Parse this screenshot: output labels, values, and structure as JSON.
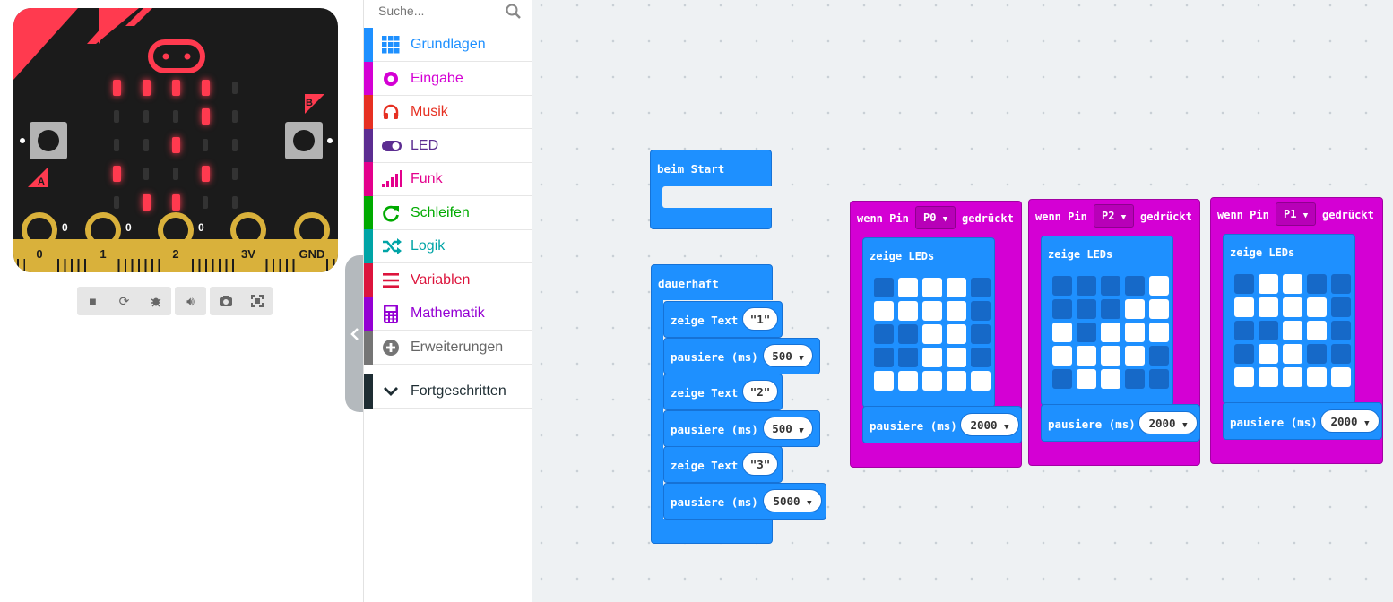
{
  "simulator": {
    "pins": [
      "0",
      "1",
      "2",
      "3V",
      "GND"
    ],
    "pin_values": [
      "0",
      "0",
      "0"
    ],
    "button_labels": [
      "A",
      "B"
    ],
    "toolbar_icons": [
      "stop-icon",
      "restart-icon",
      "debug-icon",
      "sound-icon",
      "screenshot-icon",
      "fullscreen-icon"
    ]
  },
  "search": {
    "placeholder": "Suche..."
  },
  "categories": [
    {
      "label": "Grundlagen",
      "color": "#1e90ff",
      "icon": "grid-icon"
    },
    {
      "label": "Eingabe",
      "color": "#d400d4",
      "icon": "target-icon"
    },
    {
      "label": "Musik",
      "color": "#e63022",
      "icon": "headphones-icon"
    },
    {
      "label": "LED",
      "color": "#5c2d91",
      "icon": "toggle-icon"
    },
    {
      "label": "Funk",
      "color": "#e3008c",
      "icon": "signal-icon"
    },
    {
      "label": "Schleifen",
      "color": "#00aa00",
      "icon": "loop-icon"
    },
    {
      "label": "Logik",
      "color": "#00a4a6",
      "icon": "shuffle-icon"
    },
    {
      "label": "Variablen",
      "color": "#dc143c",
      "icon": "lines-icon"
    },
    {
      "label": "Mathematik",
      "color": "#9400d3",
      "icon": "calculator-icon"
    },
    {
      "label": "Erweiterungen",
      "color": "#757575",
      "icon": "plus-circle-icon"
    },
    {
      "label": "Fortgeschritten",
      "color": "#1e2d33",
      "icon": "chevron-down-icon"
    }
  ],
  "blocks": {
    "on_start": {
      "label": "beim Start"
    },
    "forever": {
      "label": "dauerhaft",
      "statements": [
        {
          "kind": "show",
          "label": "zeige Text",
          "value": "\"1\""
        },
        {
          "kind": "pause",
          "label": "pausiere (ms)",
          "value": "500"
        },
        {
          "kind": "show",
          "label": "zeige Text",
          "value": "\"2\""
        },
        {
          "kind": "pause",
          "label": "pausiere (ms)",
          "value": "500"
        },
        {
          "kind": "show",
          "label": "zeige Text",
          "value": "\"3\""
        },
        {
          "kind": "pause",
          "label": "pausiere (ms)",
          "value": "5000"
        }
      ]
    },
    "pin_events": [
      {
        "prefix": "wenn Pin",
        "pin": "P0",
        "suffix": "gedrückt",
        "show": "zeige LEDs",
        "pause": "pausiere (ms)",
        "pause_value": "2000",
        "leds": [
          [
            0,
            1,
            1,
            1,
            0
          ],
          [
            1,
            1,
            1,
            1,
            0
          ],
          [
            0,
            0,
            1,
            1,
            0
          ],
          [
            0,
            0,
            1,
            1,
            0
          ],
          [
            1,
            1,
            1,
            1,
            1
          ]
        ]
      },
      {
        "prefix": "wenn Pin",
        "pin": "P2",
        "suffix": "gedrückt",
        "show": "zeige LEDs",
        "pause": "pausiere (ms)",
        "pause_value": "2000",
        "leds": [
          [
            0,
            0,
            0,
            0,
            1
          ],
          [
            0,
            0,
            0,
            1,
            1
          ],
          [
            1,
            0,
            1,
            1,
            1
          ],
          [
            1,
            1,
            1,
            1,
            0
          ],
          [
            0,
            1,
            1,
            0,
            0
          ]
        ]
      },
      {
        "prefix": "wenn Pin",
        "pin": "P1",
        "suffix": "gedrückt",
        "show": "zeige LEDs",
        "pause": "pausiere (ms)",
        "pause_value": "2000",
        "leds": [
          [
            0,
            1,
            1,
            0,
            0
          ],
          [
            1,
            1,
            1,
            1,
            0
          ],
          [
            0,
            0,
            1,
            1,
            0
          ],
          [
            0,
            1,
            1,
            0,
            0
          ],
          [
            1,
            1,
            1,
            1,
            1
          ]
        ]
      }
    ]
  }
}
